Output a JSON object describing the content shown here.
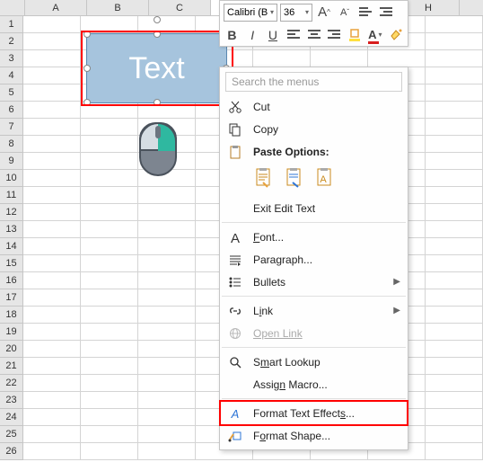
{
  "columns": [
    "A",
    "B",
    "C",
    "",
    "",
    "",
    "",
    "H"
  ],
  "row_count": 26,
  "shape": {
    "text": "Text"
  },
  "toolbar": {
    "font_name": "Calibri (B",
    "font_size": "36",
    "grow": "A",
    "shrink": "A",
    "bold": "B",
    "italic": "I",
    "underline": "U",
    "font_color": "A"
  },
  "menu": {
    "search_placeholder": "Search the menus",
    "cut": "Cut",
    "copy": "Copy",
    "paste_options": "Paste Options:",
    "exit_edit": "Exit Edit Text",
    "font": "Font...",
    "paragraph": "Paragraph...",
    "bullets": "Bullets",
    "link": "Link",
    "open_link": "Open Link",
    "smart_lookup": "Smart Lookup",
    "assign_macro": "Assign Macro...",
    "format_text_effects": "Format Text Effects...",
    "format_shape": "Format Shape..."
  }
}
